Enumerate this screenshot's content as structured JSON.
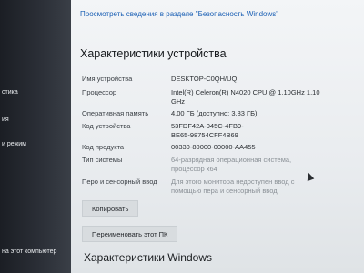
{
  "sidebar": {
    "items": [
      {
        "label": "стика"
      },
      {
        "label": "ия"
      },
      {
        "label": "и режим"
      },
      {
        "label": "на этот компьютер"
      }
    ]
  },
  "main": {
    "security_link": "Просмотреть сведения в разделе \"Безопасность Windows\"",
    "heading": "Характеристики устройства",
    "specs": [
      {
        "label": "Имя устройства",
        "value": "DESKTOP-C0QH/UQ"
      },
      {
        "label": "Процессор",
        "value": "Intel(R) Celeron(R) N4020 CPU @ 1.10GHz 1.10 GHz"
      },
      {
        "label": "Оперативная память",
        "value": "4,00 ГБ (доступно: 3,83 ГБ)"
      },
      {
        "label": "Код устройства",
        "value": "53FDF42A-045C-4FB9-BE65-98754CFF4B69"
      },
      {
        "label": "Код продукта",
        "value": "00330-80000-00000-AA455"
      },
      {
        "label": "Тип системы",
        "value": "64-разрядная операционная система, процессор x64"
      },
      {
        "label": "Перо и сенсорный ввод",
        "value": "Для этого монитора недоступен ввод с помощью пера и сенсорный ввод"
      }
    ],
    "copy_button": "Копировать",
    "rename_button": "Переименовать этот ПК",
    "windows_heading": "Характеристики Windows"
  }
}
